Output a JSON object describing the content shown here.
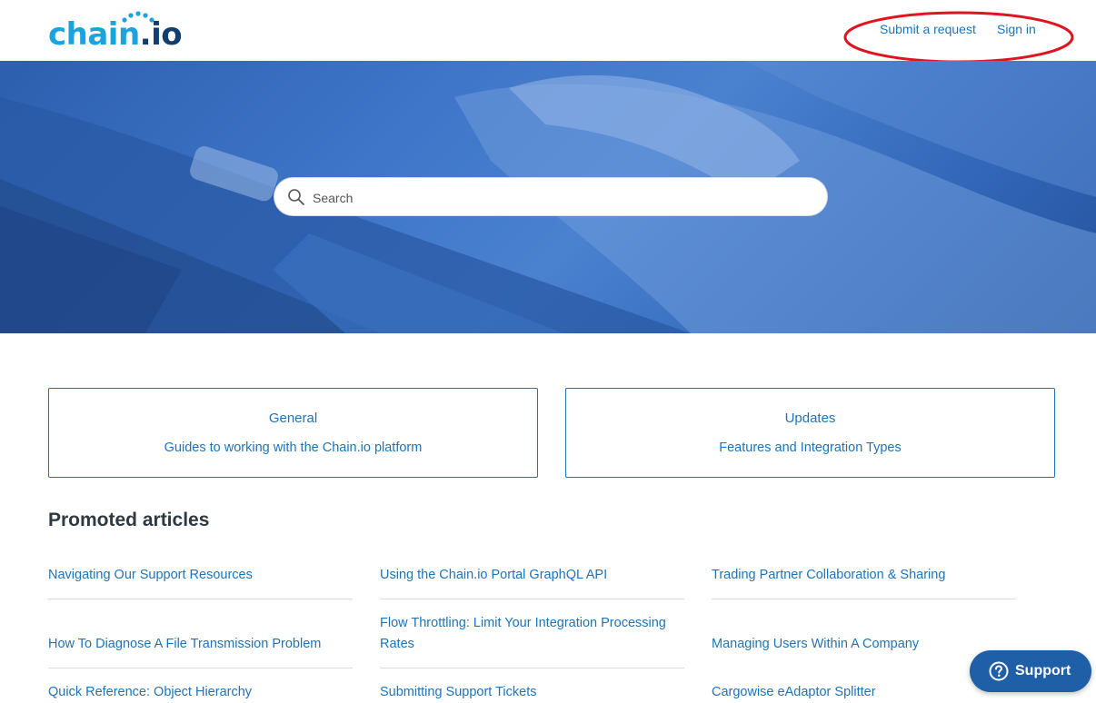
{
  "header": {
    "logo_chain": "chain",
    "logo_dot": ".",
    "logo_io": "io",
    "nav": {
      "submit_request": "Submit a request",
      "sign_in": "Sign in"
    }
  },
  "hero": {
    "search_placeholder": "Search"
  },
  "categories": [
    {
      "title": "General",
      "description": "Guides to working with the Chain.io platform"
    },
    {
      "title": "Updates",
      "description": "Features and Integration Types"
    }
  ],
  "promoted": {
    "heading": "Promoted articles",
    "articles": [
      "Navigating Our Support Resources",
      "Using the Chain.io Portal GraphQL API",
      "Trading Partner Collaboration & Sharing",
      "How To Diagnose A File Transmission Problem",
      "Flow Throttling: Limit Your Integration Processing Rates",
      "Managing Users Within A Company",
      "Quick Reference: Object Hierarchy",
      "Submitting Support Tickets",
      "Cargowise eAdaptor Splitter"
    ]
  },
  "widget": {
    "support_label": "Support",
    "icon": "question-circle-icon"
  },
  "colors": {
    "link": "#1f73b7",
    "logo_light": "#1aa3dc",
    "logo_dark": "#123e6e",
    "support_button": "#1f5fa7",
    "annotation": "#e0141e"
  }
}
